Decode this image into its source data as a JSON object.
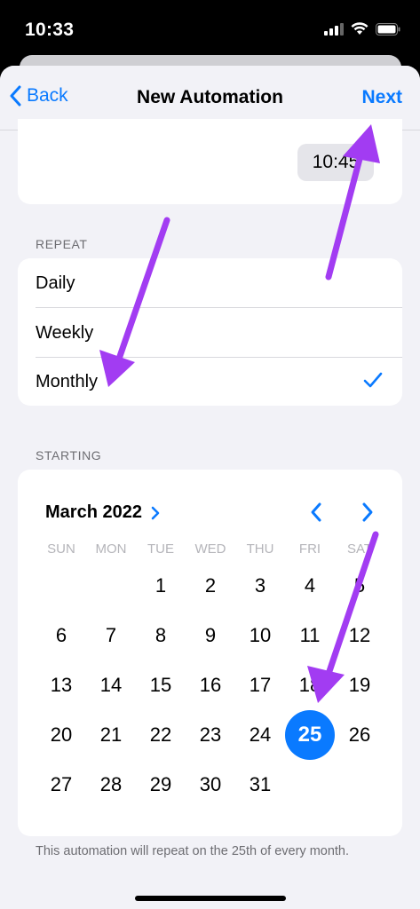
{
  "status_bar": {
    "time": "10:33"
  },
  "nav": {
    "back_label": "Back",
    "title": "New Automation",
    "next_label": "Next"
  },
  "time_field": {
    "value": "10:45"
  },
  "repeat": {
    "header": "REPEAT",
    "options": [
      {
        "label": "Daily",
        "selected": false
      },
      {
        "label": "Weekly",
        "selected": false
      },
      {
        "label": "Monthly",
        "selected": true
      }
    ]
  },
  "starting": {
    "header": "STARTING",
    "month_label": "March 2022",
    "weekdays": [
      "SUN",
      "MON",
      "TUE",
      "WED",
      "THU",
      "FRI",
      "SAT"
    ],
    "first_weekday_index": 2,
    "days": [
      "1",
      "2",
      "3",
      "4",
      "5",
      "6",
      "7",
      "8",
      "9",
      "10",
      "11",
      "12",
      "13",
      "14",
      "15",
      "16",
      "17",
      "18",
      "19",
      "20",
      "21",
      "22",
      "23",
      "24",
      "25",
      "26",
      "27",
      "28",
      "29",
      "30",
      "31"
    ],
    "selected_day": "25"
  },
  "footer_note": "This automation will repeat on the 25th of every month.",
  "colors": {
    "accent": "#0a7aff",
    "annotation_arrow": "#a23cf2",
    "background": "#f2f2f7"
  }
}
